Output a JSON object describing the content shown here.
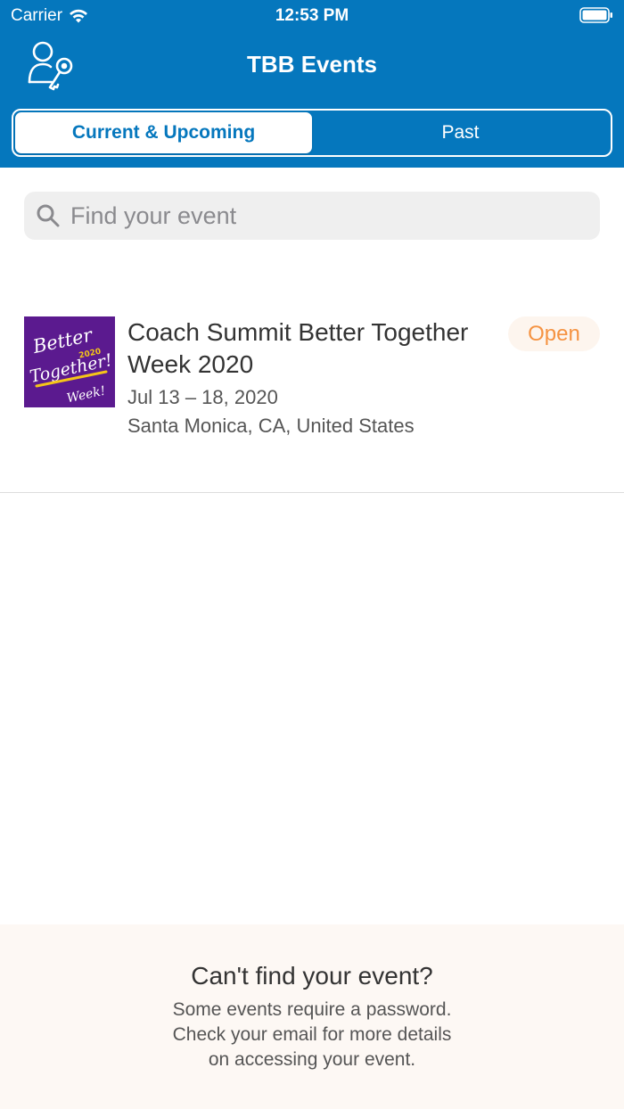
{
  "status_bar": {
    "carrier": "Carrier",
    "time": "12:53 PM"
  },
  "nav": {
    "title": "TBB Events",
    "account_icon": "user-key-icon"
  },
  "tabs": [
    {
      "label": "Current & Upcoming",
      "selected": true
    },
    {
      "label": "Past",
      "selected": false
    }
  ],
  "search": {
    "placeholder": "Find your event",
    "icon": "search-icon"
  },
  "events": [
    {
      "title": "Coach Summit Better Together Week 2020",
      "date": "Jul 13 – 18, 2020",
      "location": "Santa Monica, CA, United States",
      "status": "Open",
      "thumbnail_text": {
        "line1": "Better",
        "line2": "Together!",
        "year": "2020",
        "line3": "Week!"
      }
    }
  ],
  "footer": {
    "title": "Can't find your event?",
    "lines": [
      "Some events require a password.",
      "Check your email for more details",
      "on accessing your event."
    ]
  },
  "colors": {
    "header": "#0577bd",
    "badge_text": "#f59342",
    "badge_bg": "#fdf5ee",
    "thumbnail_bg": "#5b1a8f",
    "footer_bg": "#fdf8f4"
  }
}
